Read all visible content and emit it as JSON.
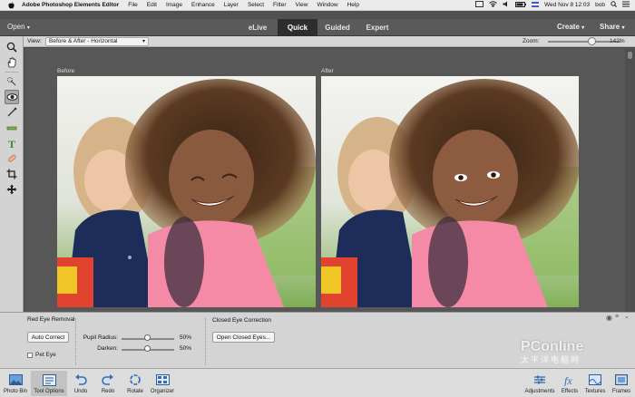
{
  "menubar": {
    "app_name": "Adobe Photoshop Elements Editor",
    "items": [
      "File",
      "Edit",
      "Image",
      "Enhance",
      "Layer",
      "Select",
      "Filter",
      "View",
      "Window",
      "Help"
    ],
    "clock": "Wed Nov 8  12:03",
    "user": "bob"
  },
  "appbar": {
    "open_label": "Open",
    "modes": [
      "eLive",
      "Quick",
      "Guided",
      "Expert"
    ],
    "active_mode": "Quick",
    "create_label": "Create",
    "share_label": "Share"
  },
  "viewbar": {
    "view_label": "View:",
    "view_value": "Before & After - Horizontal",
    "zoom_label": "Zoom:",
    "zoom_value": "142%"
  },
  "canvas": {
    "before_label": "Before",
    "after_label": "After"
  },
  "panel": {
    "red_eye_title": "Red Eye Removal",
    "auto_correct_label": "Auto Correct",
    "pet_eye_label": "Pet Eye",
    "pupil_radius_label": "Pupil Radius:",
    "pupil_radius_value": "50%",
    "pupil_radius_level": 0.5,
    "darken_label": "Darken:",
    "darken_value": "50%",
    "darken_level": 0.5,
    "closed_eye_title": "Closed Eye Correction",
    "open_closed_eyes_label": "Open Closed Eyes..."
  },
  "taskbar": {
    "left": [
      {
        "label": "Photo Bin",
        "icon": "photo-bin-icon"
      },
      {
        "label": "Tool Options",
        "icon": "tool-options-icon"
      },
      {
        "label": "Undo",
        "icon": "undo-icon"
      },
      {
        "label": "Redo",
        "icon": "redo-icon"
      },
      {
        "label": "Rotate",
        "icon": "rotate-icon"
      },
      {
        "label": "Organizer",
        "icon": "organizer-icon"
      }
    ],
    "right": [
      {
        "label": "Adjustments",
        "icon": "adjustments-icon"
      },
      {
        "label": "Effects",
        "icon": "effects-icon"
      },
      {
        "label": "Textures",
        "icon": "textures-icon"
      },
      {
        "label": "Frames",
        "icon": "frames-icon"
      }
    ]
  },
  "watermark": {
    "text": "PConline",
    "sub": "太平洋电脑网"
  }
}
